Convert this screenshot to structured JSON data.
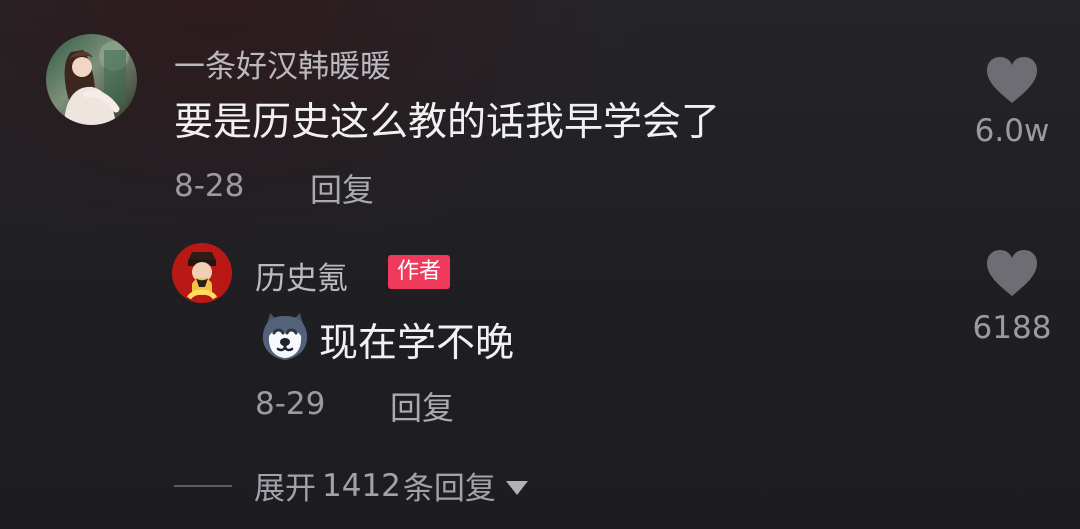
{
  "comments": [
    {
      "username": "一条好汉韩暖暖",
      "text": "要是历史这么教的话我早学会了",
      "date": "8-28",
      "reply_label": "回复",
      "likes": "6.0w",
      "like_icon": "heart-icon"
    },
    {
      "username": "历史氪",
      "badge": "作者",
      "emoji_icon": "husky-emoji",
      "text": "现在学不晚",
      "date": "8-29",
      "reply_label": "回复",
      "likes": "6188",
      "like_icon": "heart-icon"
    }
  ],
  "expand": {
    "prefix": "展开",
    "count": "1412",
    "suffix": "条回复",
    "icon": "triangle-down-icon"
  }
}
